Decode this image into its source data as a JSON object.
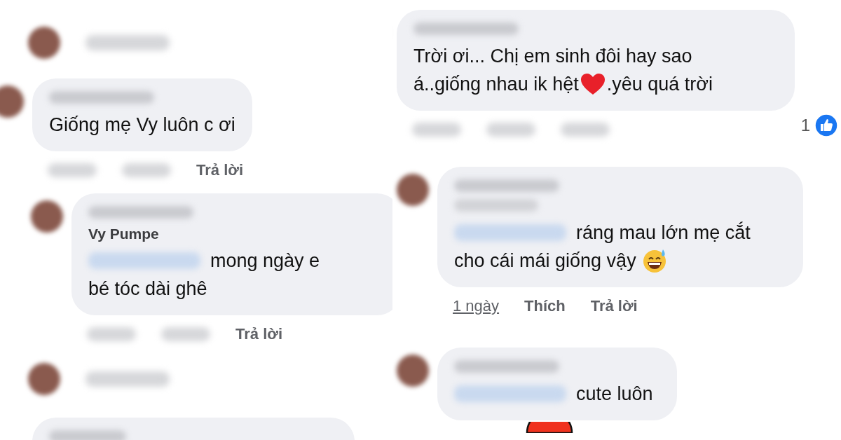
{
  "panels": [
    {
      "items": [
        {
          "kind": "blurred"
        },
        {
          "kind": "comment",
          "lines": [
            [
              {
                "kind": "text",
                "text": "Giống mẹ Vy luôn c ơi"
              }
            ]
          ],
          "actions": [
            {
              "kind": "blurred"
            },
            {
              "kind": "blurred"
            },
            {
              "kind": "text",
              "label": "Trả lời",
              "underlined": false
            }
          ],
          "children": [
            {
              "kind": "comment",
              "author": "Vy Pumpe",
              "lines": [
                [
                  {
                    "kind": "mention"
                  },
                  {
                    "kind": "text",
                    "text": "mong ngày e"
                  }
                ],
                [
                  {
                    "kind": "text",
                    "text": "bé tóc dài ghê"
                  }
                ]
              ],
              "actions": [
                {
                  "kind": "blurred"
                },
                {
                  "kind": "blurred"
                },
                {
                  "kind": "text",
                  "label": "Trả lời",
                  "underlined": false
                }
              ]
            }
          ]
        },
        {
          "kind": "blurred"
        },
        {
          "kind": "partial"
        }
      ]
    },
    {
      "items": [
        {
          "kind": "comment",
          "lines": [
            [
              {
                "kind": "text",
                "text": "Trời ơi... Chị em sinh đôi hay sao"
              }
            ],
            [
              {
                "kind": "text",
                "text": "á..giống nhau ik hệt"
              },
              {
                "kind": "heart"
              },
              {
                "kind": "text",
                "text": ".yêu quá trời"
              }
            ]
          ],
          "actions": [
            {
              "kind": "blurred"
            },
            {
              "kind": "blurred"
            },
            {
              "kind": "blurred"
            }
          ],
          "reactions": "1",
          "children": [
            {
              "kind": "comment",
              "author_blurred": true,
              "lines": [
                [
                  {
                    "kind": "mention"
                  },
                  {
                    "kind": "text",
                    "text": "ráng mau lớn mẹ cắt"
                  }
                ],
                [
                  {
                    "kind": "text",
                    "text": "cho cái mái giống vậy"
                  },
                  {
                    "kind": "sweat_smile"
                  }
                ]
              ],
              "actions": [
                {
                  "kind": "text",
                  "label": "1 ngày",
                  "underlined": true
                },
                {
                  "kind": "text",
                  "label": "Thích",
                  "underlined": false
                },
                {
                  "kind": "text",
                  "label": "Trả lời",
                  "underlined": false
                }
              ]
            },
            {
              "kind": "comment",
              "lines": [
                [
                  {
                    "kind": "mention"
                  },
                  {
                    "kind": "text",
                    "text": "cute luôn"
                  }
                ]
              ],
              "sticker": true
            }
          ]
        }
      ]
    }
  ]
}
